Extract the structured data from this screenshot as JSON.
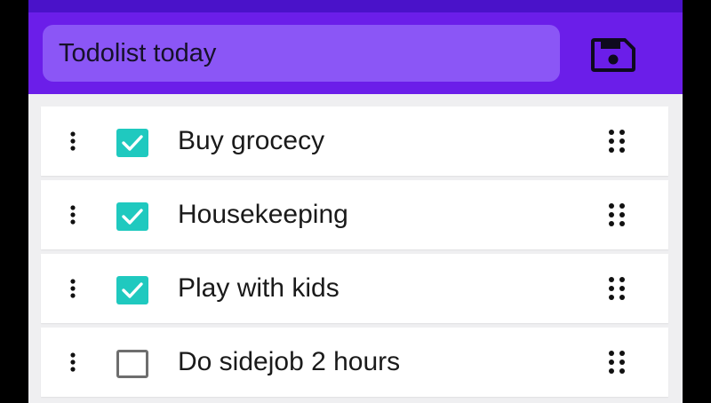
{
  "header": {
    "title_value": "Todolist today",
    "save_icon": "save-icon"
  },
  "colors": {
    "app_bar": "#6b1ee9",
    "title_field": "#8b56f6",
    "checkbox_checked": "#1fc9bf",
    "background": "#efeff1"
  },
  "icons": {
    "row_menu": "more-vertical-icon",
    "row_drag": "drag-handle-icon",
    "check": "check-icon"
  },
  "tasks": [
    {
      "label": "Buy grocecy",
      "checked": true
    },
    {
      "label": "Housekeeping",
      "checked": true
    },
    {
      "label": "Play with kids",
      "checked": true
    },
    {
      "label": "Do sidejob 2 hours",
      "checked": false
    }
  ]
}
